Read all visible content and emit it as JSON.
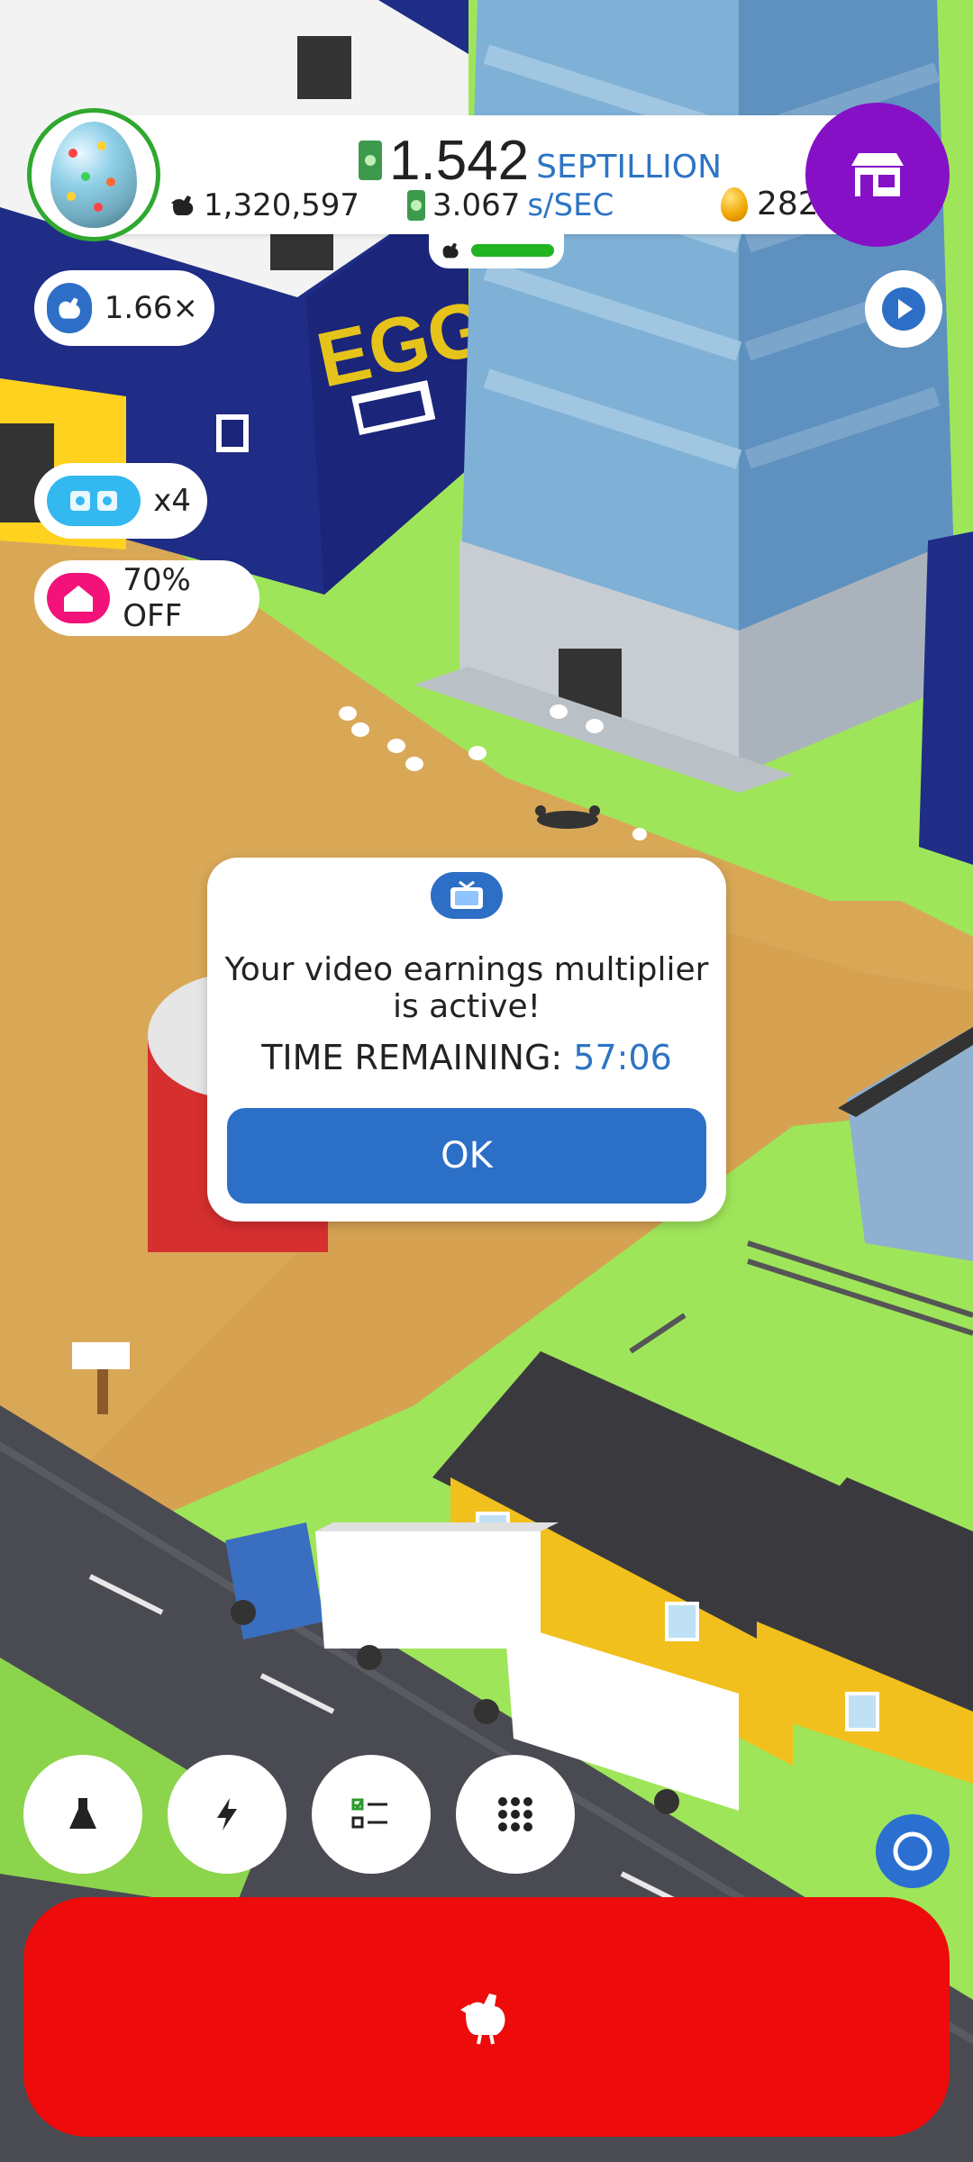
{
  "hud": {
    "money_value": "1.542",
    "money_unit": "SEPTILLION",
    "chicken_count": "1,320,597",
    "earn_rate_value": "3.067",
    "earn_rate_unit": "s/SEC",
    "golden_eggs": "282",
    "hab_fill_fraction": 1.0,
    "shop_icon": "shop-icon",
    "accent_purple": "#8510c6",
    "accent_green": "#22b322"
  },
  "boosts": {
    "multiplier_label": "1.66×",
    "drone_label": "x4",
    "sale_label": "70% OFF"
  },
  "dialog": {
    "message": "Your video earnings multiplier is active!",
    "time_label": "TIME REMAINING:",
    "time_value": "57:06",
    "ok_label": "OK",
    "icon": "tv-icon"
  },
  "toolbar": {
    "buttons": [
      "research-icon",
      "boost-icon",
      "missions-icon",
      "menu-grid-icon"
    ]
  },
  "hatch_button": {
    "icon": "chicken-icon",
    "color": "#ee0b0b"
  }
}
